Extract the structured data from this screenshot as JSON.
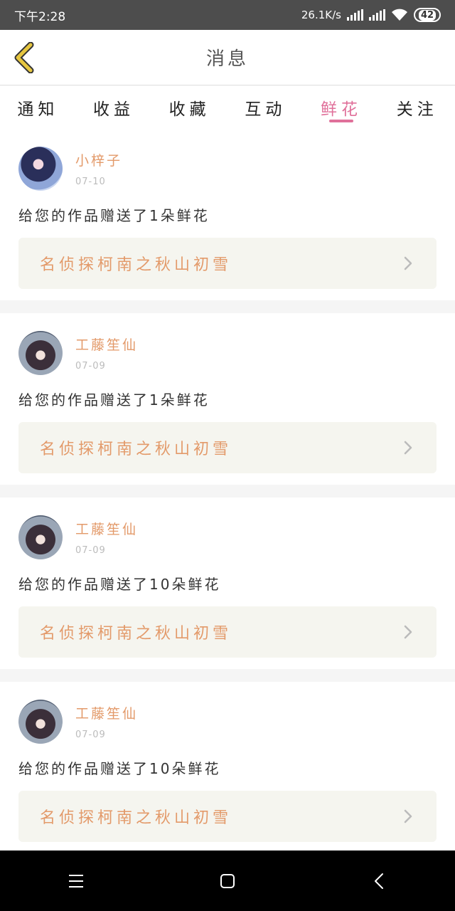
{
  "status_bar": {
    "time": "下午2:28",
    "speed": "26.1K/s",
    "battery": "42"
  },
  "header": {
    "title": "消息"
  },
  "tabs": [
    {
      "label": "通知"
    },
    {
      "label": "收益"
    },
    {
      "label": "收藏"
    },
    {
      "label": "互动"
    },
    {
      "label": "鲜花"
    },
    {
      "label": "关注"
    }
  ],
  "messages": [
    {
      "user": "小梓子",
      "date": "07-10",
      "text": "给您的作品赠送了1朵鲜花",
      "work": "名侦探柯南之秋山初雪"
    },
    {
      "user": "工藤笙仙",
      "date": "07-09",
      "text": "给您的作品赠送了1朵鲜花",
      "work": "名侦探柯南之秋山初雪"
    },
    {
      "user": "工藤笙仙",
      "date": "07-09",
      "text": "给您的作品赠送了10朵鲜花",
      "work": "名侦探柯南之秋山初雪"
    },
    {
      "user": "工藤笙仙",
      "date": "07-09",
      "text": "给您的作品赠送了10朵鲜花",
      "work": "名侦探柯南之秋山初雪"
    }
  ],
  "colors": {
    "accent": "#e0709a",
    "username": "#e39a6a",
    "back_arrow": "#e6c640"
  }
}
